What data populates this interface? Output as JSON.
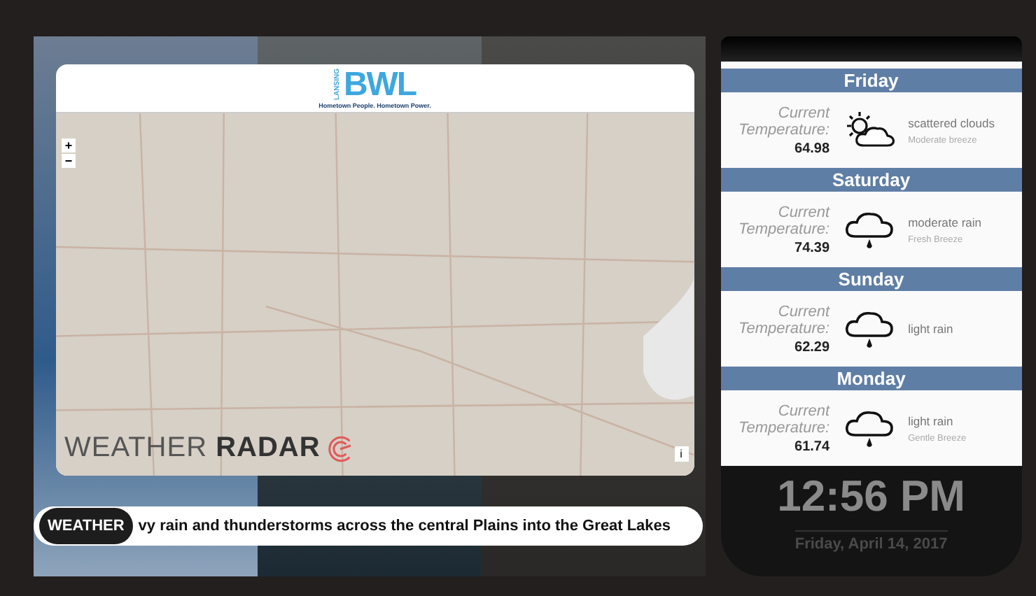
{
  "logo": {
    "letters": "BWL",
    "city": "LANSING",
    "tagline": "Hometown People. Hometown Power."
  },
  "map": {
    "zoom_in": "+",
    "zoom_out": "−",
    "info": "i",
    "title_light": "WEATHER",
    "title_bold": "RADAR"
  },
  "ticker": {
    "label": "WEATHER",
    "text": "vy rain and thunderstorms across the central Plains into the Great Lakes"
  },
  "forecast": [
    {
      "day": "Friday",
      "label": "Current Temperature:",
      "temp": "64.98",
      "kind": "sun-cloud",
      "condition": "scattered clouds",
      "wind": "Moderate breeze"
    },
    {
      "day": "Saturday",
      "label": "Current Temperature:",
      "temp": "74.39",
      "kind": "rain",
      "condition": "moderate rain",
      "wind": "Fresh Breeze"
    },
    {
      "day": "Sunday",
      "label": "Current Temperature:",
      "temp": "62.29",
      "kind": "rain",
      "condition": "light rain"
    },
    {
      "day": "Monday",
      "label": "Current Temperature:",
      "temp": "61.74",
      "kind": "rain",
      "condition": "light rain",
      "wind": "Gentle Breeze"
    }
  ],
  "clock": {
    "time": "12:56 PM",
    "date": "Friday, April 14, 2017"
  }
}
